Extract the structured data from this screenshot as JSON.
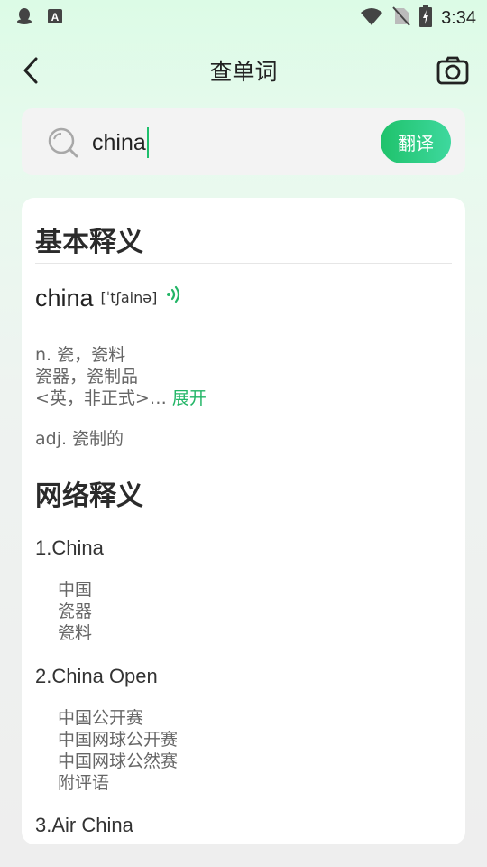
{
  "status_bar": {
    "time": "3:34",
    "icons": [
      "qq-icon",
      "a-badge-icon",
      "wifi-icon",
      "no-sim-icon",
      "battery-icon"
    ]
  },
  "header": {
    "title": "查单词",
    "back_icon": "chevron-left-icon",
    "camera_icon": "camera-icon"
  },
  "search": {
    "value": "china",
    "button_label": "翻译",
    "icon": "search-icon"
  },
  "basic": {
    "section_title": "基本释义",
    "word": "china",
    "phonetic": "[ˈtʃainə]",
    "definitions": [
      "n. 瓷，瓷料",
      "瓷器，瓷制品",
      "<英，非正式>…"
    ],
    "expand_label": "展开",
    "adj": "adj. 瓷制的"
  },
  "web": {
    "section_title": "网络释义",
    "entries": [
      {
        "head": "1.China",
        "items": [
          "中国",
          "瓷器",
          "瓷料"
        ]
      },
      {
        "head": "2.China Open",
        "items": [
          "中国公开赛",
          "中国网球公开赛",
          "中国网球公然赛",
          "附评语"
        ]
      },
      {
        "head": "3.Air China",
        "items": []
      }
    ]
  },
  "colors": {
    "accent": "#1fc26b",
    "background_top": "#dcfbe6",
    "card": "#ffffff"
  }
}
